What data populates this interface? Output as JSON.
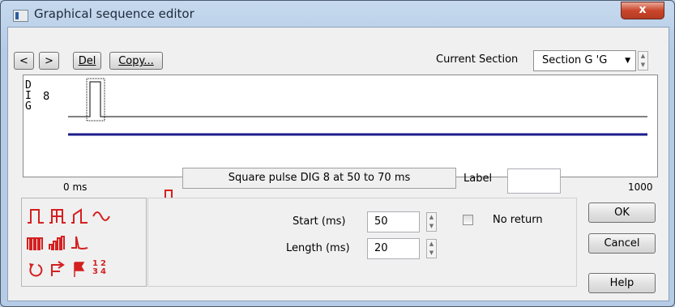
{
  "window": {
    "title": "Graphical sequence editor",
    "close_label": "x"
  },
  "toolbar": {
    "prev_label": "<",
    "next_label": ">",
    "del_label": "Del",
    "copy_label": "Copy..."
  },
  "section": {
    "label": "Current Section",
    "selected": "Section G 'G"
  },
  "display": {
    "channel_label_lines": [
      "D",
      "I",
      "G"
    ],
    "channel_number": "8",
    "axis_start": "0 ms",
    "axis_end": "1000",
    "colors": {
      "baseline": "#000000",
      "time_bar": "#1c1c8c"
    }
  },
  "pulse_info": {
    "text": "Square pulse DIG 8 at 50 to 70 ms",
    "label_caption": "Label",
    "label_value": ""
  },
  "fields": {
    "start_label": "Start (ms)",
    "start_value": "50",
    "length_label": "Length (ms)",
    "length_value": "20",
    "no_return_label": "No return",
    "no_return_checked": false
  },
  "buttons": {
    "ok": "OK",
    "cancel": "Cancel",
    "help": "Help"
  },
  "palette": {
    "icons": [
      "square-pulse",
      "multi-level-pulse",
      "ramp-pulse",
      "sine-wave",
      "pulse-train",
      "variable-pulse-train",
      "spike",
      "return-arrow",
      "repeat-arrow",
      "flag-marker",
      "numbers"
    ],
    "number_icon_text": [
      "1",
      "2",
      "3",
      "4"
    ],
    "color": "#d42020"
  }
}
